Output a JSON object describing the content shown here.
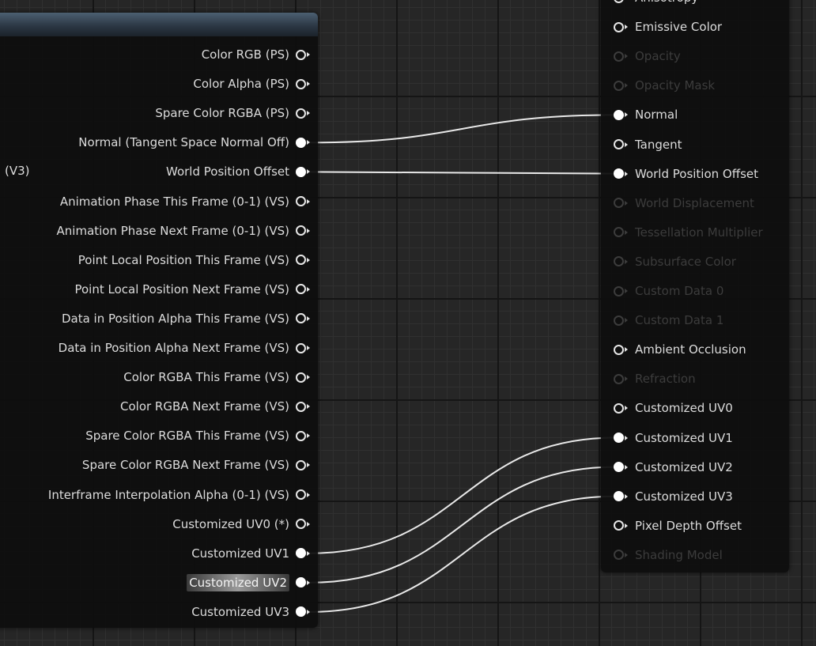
{
  "left_node": {
    "side_label": "(V3)",
    "pins": [
      {
        "label": "Color RGB (PS)",
        "connected": false
      },
      {
        "label": "Color Alpha (PS)",
        "connected": false
      },
      {
        "label": "Spare Color RGBA (PS)",
        "connected": false
      },
      {
        "label": "Normal (Tangent Space Normal Off)",
        "connected": true
      },
      {
        "label": "World Position Offset",
        "connected": true
      },
      {
        "label": "Animation Phase This Frame (0-1) (VS)",
        "connected": false
      },
      {
        "label": "Animation Phase Next Frame (0-1) (VS)",
        "connected": false
      },
      {
        "label": "Point Local Position This Frame (VS)",
        "connected": false
      },
      {
        "label": "Point Local Position Next Frame (VS)",
        "connected": false
      },
      {
        "label": "Data in Position Alpha This Frame (VS)",
        "connected": false
      },
      {
        "label": "Data in Position Alpha Next Frame (VS)",
        "connected": false
      },
      {
        "label": "Color RGBA This Frame (VS)",
        "connected": false
      },
      {
        "label": "Color RGBA Next Frame (VS)",
        "connected": false
      },
      {
        "label": "Spare Color RGBA This Frame (VS)",
        "connected": false
      },
      {
        "label": "Spare Color RGBA Next Frame (VS)",
        "connected": false
      },
      {
        "label": "Interframe Interpolation Alpha (0-1) (VS)",
        "connected": false
      },
      {
        "label": "Customized UV0 (*)",
        "connected": false
      },
      {
        "label": "Customized UV1",
        "connected": true
      },
      {
        "label": "Customized UV2",
        "connected": true,
        "highlighted": true
      },
      {
        "label": "Customized UV3",
        "connected": true
      }
    ]
  },
  "right_node": {
    "pins": [
      {
        "label": "Anisotropy",
        "enabled": true,
        "connected": false
      },
      {
        "label": "Emissive Color",
        "enabled": true,
        "connected": false
      },
      {
        "label": "Opacity",
        "enabled": false,
        "connected": false
      },
      {
        "label": "Opacity Mask",
        "enabled": false,
        "connected": false
      },
      {
        "label": "Normal",
        "enabled": true,
        "connected": true
      },
      {
        "label": "Tangent",
        "enabled": true,
        "connected": false
      },
      {
        "label": "World Position Offset",
        "enabled": true,
        "connected": true
      },
      {
        "label": "World Displacement",
        "enabled": false,
        "connected": false
      },
      {
        "label": "Tessellation Multiplier",
        "enabled": false,
        "connected": false
      },
      {
        "label": "Subsurface Color",
        "enabled": false,
        "connected": false
      },
      {
        "label": "Custom Data 0",
        "enabled": false,
        "connected": false
      },
      {
        "label": "Custom Data 1",
        "enabled": false,
        "connected": false
      },
      {
        "label": "Ambient Occlusion",
        "enabled": true,
        "connected": false
      },
      {
        "label": "Refraction",
        "enabled": false,
        "connected": false
      },
      {
        "label": "Customized UV0",
        "enabled": true,
        "connected": false
      },
      {
        "label": "Customized UV1",
        "enabled": true,
        "connected": true
      },
      {
        "label": "Customized UV2",
        "enabled": true,
        "connected": true
      },
      {
        "label": "Customized UV3",
        "enabled": true,
        "connected": true
      },
      {
        "label": "Pixel Depth Offset",
        "enabled": true,
        "connected": false
      },
      {
        "label": "Shading Model",
        "enabled": false,
        "connected": false
      }
    ]
  },
  "colors": {
    "wire": "#e8e8e8",
    "pin": "#e6e6e6",
    "disabled": "#3c3c3c",
    "header": "#2c3845"
  }
}
